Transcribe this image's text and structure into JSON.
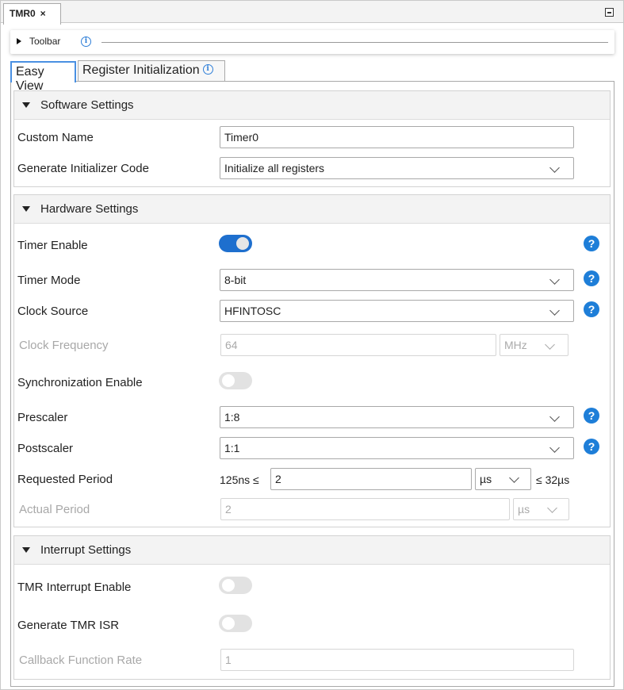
{
  "editor_tab": {
    "label": "TMR0",
    "close": "×"
  },
  "toolbar": {
    "label": "Toolbar",
    "info": "i"
  },
  "view_tabs": [
    {
      "label": "Easy View",
      "active": true
    },
    {
      "label": "Register Initialization",
      "info": "i"
    }
  ],
  "software": {
    "title": "Software Settings",
    "custom_name": {
      "label": "Custom Name",
      "value": "Timer0"
    },
    "generate_init": {
      "label": "Generate Initializer Code",
      "value": "Initialize all registers"
    }
  },
  "hardware": {
    "title": "Hardware Settings",
    "timer_enable": {
      "label": "Timer Enable",
      "on": true
    },
    "timer_mode": {
      "label": "Timer Mode",
      "value": "8-bit"
    },
    "clock_source": {
      "label": "Clock Source",
      "value": "HFINTOSC"
    },
    "clock_frequency": {
      "label": "Clock Frequency",
      "value": "64",
      "unit": "MHz"
    },
    "sync_enable": {
      "label": "Synchronization Enable",
      "on": false
    },
    "prescaler": {
      "label": "Prescaler",
      "value": "1:8"
    },
    "postscaler": {
      "label": "Postscaler",
      "value": "1:1"
    },
    "requested_period": {
      "label": "Requested Period",
      "min": "125ns ≤",
      "value": "2",
      "unit": "µs",
      "max": "≤ 32µs"
    },
    "actual_period": {
      "label": "Actual Period",
      "value": "2",
      "unit": "µs"
    }
  },
  "interrupt": {
    "title": "Interrupt Settings",
    "tmr_interrupt": {
      "label": "TMR Interrupt Enable",
      "on": false
    },
    "generate_isr": {
      "label": "Generate TMR ISR",
      "on": false
    },
    "callback_rate": {
      "label": "Callback Function Rate",
      "value": "1"
    }
  },
  "help_glyph": "?",
  "colors": {
    "accent": "#1e7ed8",
    "toggle_on": "#1e6fce",
    "toggle_off": "#e2e2e2"
  }
}
